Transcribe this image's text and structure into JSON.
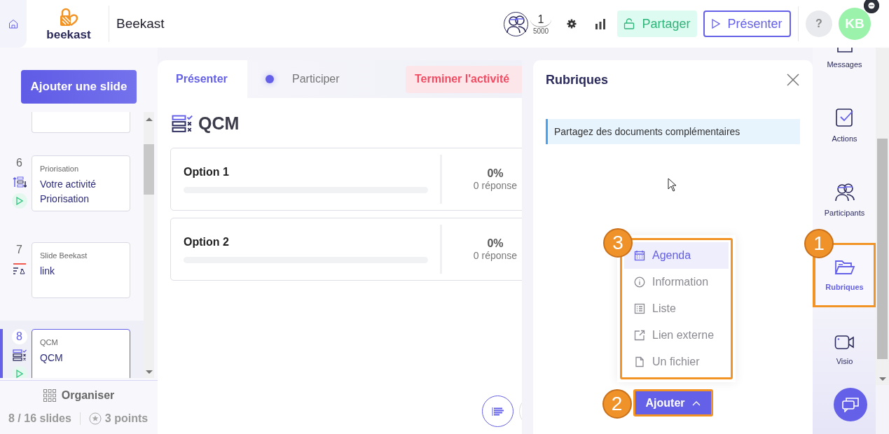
{
  "header": {
    "logo_text": "beekast",
    "title": "Beekast",
    "participants": {
      "current": "1",
      "max": "5000"
    },
    "share_button": "Partager",
    "present_button": "Présenter",
    "help_button": "?",
    "avatar": "KB"
  },
  "slides_panel": {
    "add_button": "Ajouter une slide",
    "slides": [
      {
        "number": "6",
        "type": "Priorisation",
        "title": "Votre activité Priorisation",
        "kind": "ranking",
        "playable": true,
        "selected": false
      },
      {
        "number": "7",
        "type": "Slide Beekast",
        "title": "link",
        "kind": "slide",
        "playable": false,
        "selected": false
      },
      {
        "number": "8",
        "type": "QCM",
        "title": "QCM",
        "kind": "quiz",
        "playable": true,
        "selected": true
      }
    ],
    "organise_button": "Organiser",
    "slide_count": "8 / 16 slides",
    "points": "3 points"
  },
  "main": {
    "tabs": [
      {
        "label": "Présenter",
        "selected": true
      },
      {
        "label": "Participer",
        "selected": false
      }
    ],
    "end_button": "Terminer l'activité",
    "question": "QCM",
    "options": [
      {
        "label": "Option 1",
        "level": 0,
        "percent": "0%",
        "responses": "0 réponse"
      },
      {
        "label": "Option 2",
        "level": 0,
        "percent": "0%",
        "responses": "0 réponse"
      }
    ]
  },
  "panel": {
    "title": "Rubriques",
    "info": "Partagez des documents complémentaires",
    "menu": {
      "highlighted": true,
      "badge": "3",
      "items": [
        {
          "label": "Agenda",
          "kind": "agenda",
          "selected": true
        },
        {
          "label": "Information",
          "kind": "info",
          "selected": false
        },
        {
          "label": "Liste",
          "kind": "list",
          "selected": false
        },
        {
          "label": "Lien externe",
          "kind": "link",
          "selected": false
        },
        {
          "label": "Un fichier",
          "kind": "file",
          "selected": false
        }
      ]
    },
    "add_button": {
      "label": "Ajouter",
      "highlighted": true,
      "badge": "2"
    }
  },
  "rail": [
    {
      "label": "Messages",
      "kind": "messages",
      "selected": false,
      "highlighted": false
    },
    {
      "label": "Actions",
      "kind": "actions",
      "selected": false,
      "highlighted": false
    },
    {
      "label": "Participants",
      "kind": "participants",
      "selected": false,
      "highlighted": false
    },
    {
      "label": "Rubriques",
      "kind": "folder",
      "selected": true,
      "highlighted": true,
      "badge": "1"
    },
    {
      "label": "Visio",
      "kind": "video",
      "selected": false,
      "highlighted": false
    }
  ]
}
